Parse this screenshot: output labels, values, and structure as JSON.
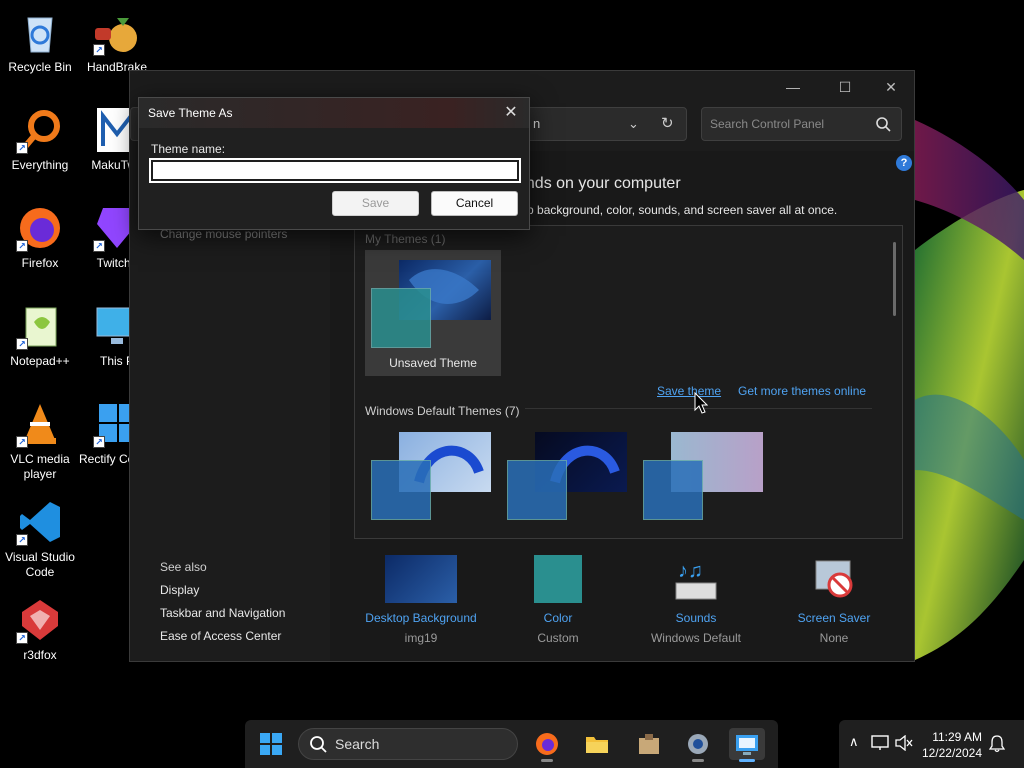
{
  "desktop": {
    "icons": [
      {
        "label": "Recycle Bin",
        "icon": "recycle-bin-icon"
      },
      {
        "label": "HandBrake",
        "icon": "handbrake-icon"
      },
      {
        "label": "Everything",
        "icon": "everything-icon"
      },
      {
        "label": "MakuTwe",
        "icon": "makutweaker-icon"
      },
      {
        "label": "Firefox",
        "icon": "firefox-icon"
      },
      {
        "label": "TwitchL",
        "icon": "twitch-icon"
      },
      {
        "label": "Notepad++",
        "icon": "notepadpp-icon"
      },
      {
        "label": "This P",
        "icon": "this-pc-icon"
      },
      {
        "label": "VLC media player",
        "icon": "vlc-icon"
      },
      {
        "label": "Rectify Contro",
        "icon": "rectify-icon"
      },
      {
        "label": "Visual Studio Code",
        "icon": "vscode-icon"
      },
      {
        "label": "r3dfox",
        "icon": "r3dfox-icon"
      }
    ]
  },
  "control_panel": {
    "address_text": "n",
    "search_placeholder": "Search Control Panel",
    "left_pane": {
      "faded_link": "Change mouse pointers",
      "see_also_title": "See also",
      "see_also": [
        "Display",
        "Taskbar and Navigation",
        "Ease of Access Center"
      ]
    },
    "heading": "unds on your computer",
    "subheading": "top background, color, sounds, and screen saver all at once.",
    "my_themes_title": "My Themes (1)",
    "unsaved_theme_label": "Unsaved Theme",
    "save_theme_link": "Save theme",
    "get_more_link": "Get more themes online",
    "default_themes_title": "Windows Default Themes (7)",
    "bottom": [
      {
        "link": "Desktop Background",
        "value": "img19"
      },
      {
        "link": "Color",
        "value": "Custom"
      },
      {
        "link": "Sounds",
        "value": "Windows Default"
      },
      {
        "link": "Screen Saver",
        "value": "None"
      }
    ]
  },
  "dialog": {
    "title": "Save Theme As",
    "field_label": "Theme name:",
    "field_value": "",
    "save_label": "Save",
    "cancel_label": "Cancel"
  },
  "taskbar": {
    "search_label": "Search",
    "time": "11:29 AM",
    "date": "12/22/2024"
  },
  "colors": {
    "accent_link": "#4fa3f2",
    "theme_color_swatch": "#2a8f8f"
  }
}
